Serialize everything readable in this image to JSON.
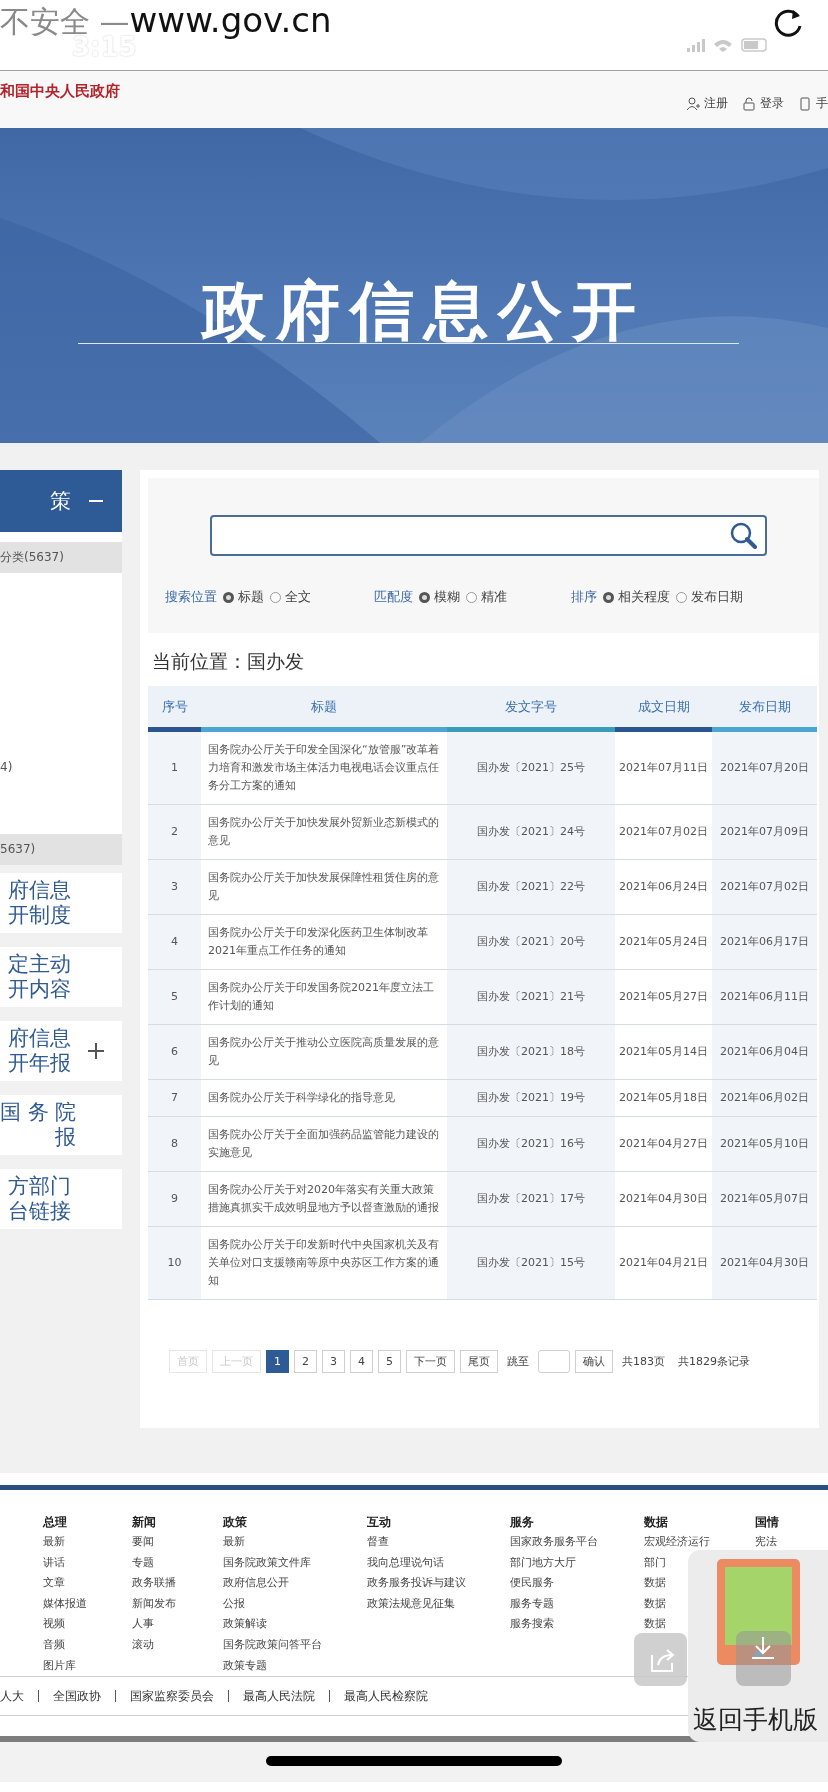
{
  "browser": {
    "security": "不安全 —",
    "url": "www.gov.cn",
    "time": "3:15"
  },
  "header": {
    "site_title": "和国中央人民政府",
    "links": [
      {
        "label": "注册",
        "kind": "user"
      },
      {
        "label": "登录",
        "kind": "lock"
      },
      {
        "label": "手",
        "kind": "phone"
      }
    ]
  },
  "banner": {
    "title": "政府信息公开"
  },
  "sidebar": {
    "header": {
      "label": "策",
      "expanded": true
    },
    "items": [
      {
        "label": "分类(5637)",
        "kind": "group"
      },
      {
        "label": "4)",
        "kind": "item"
      },
      {
        "label": "5637)",
        "kind": "group"
      }
    ],
    "cards": [
      {
        "lines": [
          "府信息",
          "开制度"
        ],
        "expandable": false
      },
      {
        "lines": [
          "定主动",
          "开内容"
        ],
        "expandable": false
      },
      {
        "lines": [
          "府信息",
          "开年报"
        ],
        "expandable": true
      },
      {
        "lines": [
          "国 务 院",
          "报"
        ],
        "expandable": false
      },
      {
        "lines": [
          "方部门",
          "台链接"
        ],
        "expandable": false
      }
    ]
  },
  "search": {
    "groups": [
      {
        "label": "搜索位置",
        "options": [
          {
            "label": "标题",
            "selected": true
          },
          {
            "label": "全文",
            "selected": false
          }
        ]
      },
      {
        "label": "匹配度",
        "options": [
          {
            "label": "模糊",
            "selected": true
          },
          {
            "label": "精准",
            "selected": false
          }
        ]
      },
      {
        "label": "排序",
        "options": [
          {
            "label": "相关程度",
            "selected": true
          },
          {
            "label": "发布日期",
            "selected": false
          }
        ]
      }
    ]
  },
  "breadcrumb": "当前位置：国办发",
  "table": {
    "columns": [
      "序号",
      "标题",
      "发文字号",
      "成文日期",
      "发布日期"
    ],
    "rows": [
      [
        "1",
        "国务院办公厅关于印发全国深化“放管服”改革着力培育和激发市场主体活力电视电话会议重点任务分工方案的通知",
        "国办发〔2021〕25号",
        "2021年07月11日",
        "2021年07月20日"
      ],
      [
        "2",
        "国务院办公厅关于加快发展外贸新业态新模式的意见",
        "国办发〔2021〕24号",
        "2021年07月02日",
        "2021年07月09日"
      ],
      [
        "3",
        "国务院办公厅关于加快发展保障性租赁住房的意见",
        "国办发〔2021〕22号",
        "2021年06月24日",
        "2021年07月02日"
      ],
      [
        "4",
        "国务院办公厅关于印发深化医药卫生体制改革2021年重点工作任务的通知",
        "国办发〔2021〕20号",
        "2021年05月24日",
        "2021年06月17日"
      ],
      [
        "5",
        "国务院办公厅关于印发国务院2021年度立法工作计划的通知",
        "国办发〔2021〕21号",
        "2021年05月27日",
        "2021年06月11日"
      ],
      [
        "6",
        "国务院办公厅关于推动公立医院高质量发展的意见",
        "国办发〔2021〕18号",
        "2021年05月14日",
        "2021年06月04日"
      ],
      [
        "7",
        "国务院办公厅关于科学绿化的指导意见",
        "国办发〔2021〕19号",
        "2021年05月18日",
        "2021年06月02日"
      ],
      [
        "8",
        "国务院办公厅关于全面加强药品监管能力建设的实施意见",
        "国办发〔2021〕16号",
        "2021年04月27日",
        "2021年05月10日"
      ],
      [
        "9",
        "国务院办公厅关于对2020年落实有关重大政策措施真抓实干成效明显地方予以督查激励的通报",
        "国办发〔2021〕17号",
        "2021年04月30日",
        "2021年05月07日"
      ],
      [
        "10",
        "国务院办公厅关于印发新时代中央国家机关及有关单位对口支援赣南等原中央苏区工作方案的通知",
        "国办发〔2021〕15号",
        "2021年04月21日",
        "2021年04月30日"
      ]
    ]
  },
  "pagination": {
    "buttons": [
      {
        "label": "首页",
        "kind": "nav",
        "disabled": true
      },
      {
        "label": "上一页",
        "kind": "nav",
        "disabled": true
      },
      {
        "label": "1",
        "kind": "page",
        "selected": true
      },
      {
        "label": "2",
        "kind": "page",
        "selected": false
      },
      {
        "label": "3",
        "kind": "page",
        "selected": false
      },
      {
        "label": "4",
        "kind": "page",
        "selected": false
      },
      {
        "label": "5",
        "kind": "page",
        "selected": false
      },
      {
        "label": "下一页",
        "kind": "nav",
        "disabled": false
      },
      {
        "label": "尾页",
        "kind": "nav",
        "disabled": false
      }
    ],
    "jump_label": "跳至",
    "confirm": "确认",
    "total_pages": "共183页",
    "total_records": "共1829条记录"
  },
  "footer": {
    "columns": [
      {
        "title": "总理",
        "items": [
          "最新",
          "讲话",
          "文章",
          "媒体报道",
          "视频",
          "音频",
          "图片库"
        ]
      },
      {
        "title": "新闻",
        "items": [
          "要闻",
          "专题",
          "政务联播",
          "新闻发布",
          "人事",
          "滚动"
        ]
      },
      {
        "title": "政策",
        "items": [
          "最新",
          "国务院政策文件库",
          "政府信息公开",
          "公报",
          "政策解读",
          "国务院政策问答平台",
          "政策专题"
        ]
      },
      {
        "title": "互动",
        "items": [
          "督查",
          "我向总理说句话",
          "政务服务投诉与建议",
          "政策法规意见征集"
        ]
      },
      {
        "title": "服务",
        "items": [
          "国家政务服务平台",
          "部门地方大厅",
          "便民服务",
          "服务专题",
          "服务搜索"
        ]
      },
      {
        "title": "数据",
        "items": [
          "宏观经济运行",
          "部门",
          "数据",
          "数据",
          "数据"
        ]
      },
      {
        "title": "国情",
        "items": [
          "宪法"
        ]
      }
    ],
    "links": [
      "人大",
      "全国政协",
      "国家监察委员会",
      "最高人民法院",
      "最高人民检察院"
    ]
  },
  "mobile_widget": {
    "label": "返回手机版"
  }
}
